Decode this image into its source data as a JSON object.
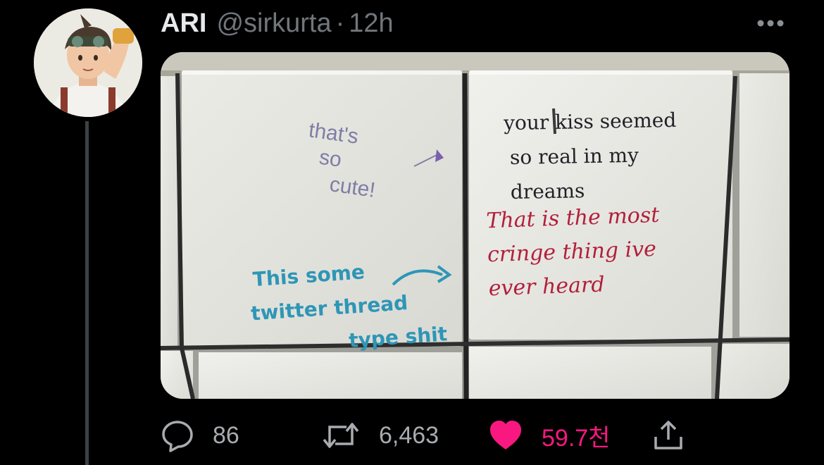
{
  "tweet": {
    "author_name": "ARI",
    "author_handle": "@sirkurta",
    "separator": "·",
    "time": "12h",
    "more_icon": "more-horizontal-icon"
  },
  "media": {
    "tile_notes": {
      "purple": "that's\nso\ncute!",
      "black": "your kiss seemed\nso real in my\ndreams",
      "red": "That is the most\ncringe thing ive\never heard",
      "blue": "This some\ntwitter thread\ntype shit"
    }
  },
  "actions": {
    "reply": {
      "icon": "reply-bubble-icon",
      "count": "86"
    },
    "retweet": {
      "icon": "retweet-icon",
      "count": "6,463"
    },
    "like": {
      "icon": "heart-filled-icon",
      "count": "59.7천",
      "color": "#f91880"
    },
    "share": {
      "icon": "share-icon"
    }
  },
  "colors": {
    "background": "#000000",
    "muted": "#71767b",
    "like_pink": "#f91880"
  }
}
